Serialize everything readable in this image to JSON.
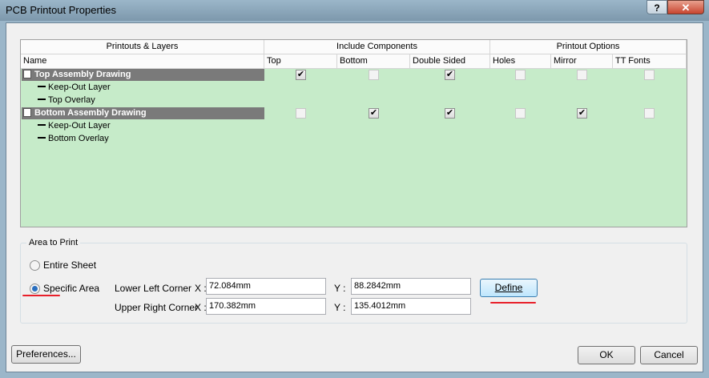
{
  "window": {
    "title": "PCB Printout Properties",
    "help_label": "?",
    "close_label": "✕"
  },
  "grid": {
    "group_headers": [
      "Printouts & Layers",
      "Include Components",
      "Printout Options"
    ],
    "columns": [
      "Name",
      "Top",
      "Bottom",
      "Double Sided",
      "Holes",
      "Mirror",
      "TT Fonts"
    ],
    "rows": [
      {
        "kind": "group",
        "label": "Top Assembly Drawing",
        "checks": [
          true,
          false,
          true,
          false,
          false,
          false
        ]
      },
      {
        "kind": "layer",
        "label": "Keep-Out Layer"
      },
      {
        "kind": "layer",
        "label": "Top Overlay"
      },
      {
        "kind": "group",
        "label": "Bottom Assembly Drawing",
        "checks": [
          false,
          true,
          true,
          false,
          true,
          false
        ]
      },
      {
        "kind": "layer",
        "label": "Keep-Out Layer"
      },
      {
        "kind": "layer",
        "label": "Bottom Overlay"
      }
    ]
  },
  "area": {
    "title": "Area to Print",
    "entire_sheet": "Entire Sheet",
    "specific_area": "Specific Area",
    "selected": "specific",
    "lower_left_label": "Lower Left Corner",
    "upper_right_label": "Upper Right Corner",
    "x_label": "X :",
    "y_label": "Y :",
    "lower_left_x": "72.084mm",
    "lower_left_y": "88.2842mm",
    "upper_right_x": "170.382mm",
    "upper_right_y": "135.4012mm",
    "define_label": "Define"
  },
  "footer": {
    "preferences_label": "Preferences...",
    "ok_label": "OK",
    "cancel_label": "Cancel"
  },
  "colors": {
    "grid_bg": "#c6ebc9",
    "group_row_bg": "#7a7a7a",
    "annotation_red": "#e8202a"
  }
}
